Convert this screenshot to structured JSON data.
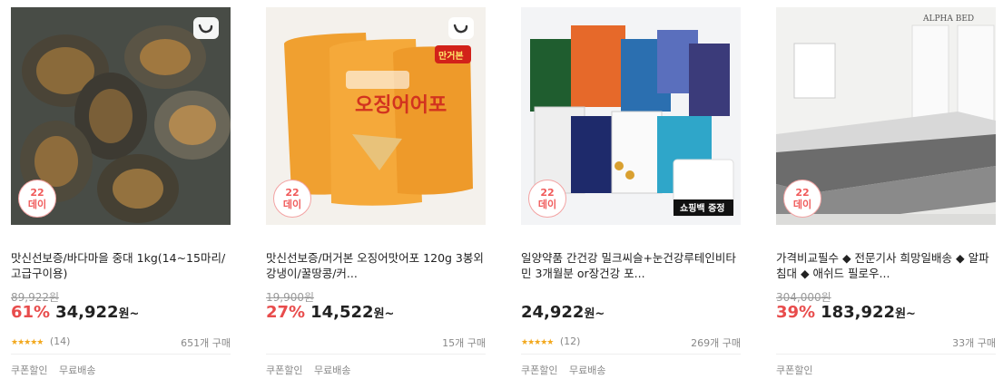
{
  "products": [
    {
      "title": "맛신선보증/바다마을 중대 1kg(14~15마리/고급구이용)",
      "badge_line1": "22",
      "badge_line2": "데이",
      "original_price": "89,922원",
      "discount": "61%",
      "price": "34,922",
      "won": "원~",
      "stars": "★★★★★",
      "reviews": "(14)",
      "sold": "651개 구매",
      "tags": [
        "쿠폰할인",
        "무료배송"
      ]
    },
    {
      "title": "맛신선보증/머거본 오징어맛어포 120g 3봉외 강냉이/꿀땅콩/커...",
      "badge_line1": "22",
      "badge_line2": "데이",
      "original_price": "19,900원",
      "discount": "27%",
      "price": "14,522",
      "won": "원~",
      "stars": "",
      "reviews": "",
      "sold": "15개 구매",
      "tags": [
        "쿠폰할인",
        "무료배송"
      ],
      "image_text": {
        "product_name": "오징어어포",
        "sticker": "만거본"
      }
    },
    {
      "title": "일양약품 간건강 밀크씨슬+눈건강루테인비타민 3개월분 or장건강 포...",
      "badge_line1": "22",
      "badge_line2": "데이",
      "original_price": "",
      "discount": "",
      "price": "24,922",
      "won": "원~",
      "stars": "★★★★★",
      "reviews": "(12)",
      "sold": "269개 구매",
      "tags": [
        "쿠폰할인",
        "무료배송"
      ],
      "image_text": {
        "gift": "쇼핑백 증정"
      }
    },
    {
      "title": "가격비교필수 ◆ 전문기사 희망일배송 ◆ 알파침대 ◆ 애쉬드 필로우...",
      "badge_line1": "22",
      "badge_line2": "데이",
      "original_price": "304,000원",
      "discount": "39%",
      "price": "183,922",
      "won": "원~",
      "stars": "",
      "reviews": "",
      "sold": "33개 구매",
      "tags": [
        "쿠폰할인"
      ],
      "image_text": {
        "brand": "ALPHA BED"
      }
    }
  ],
  "colors": {
    "discount": "#e84c4c",
    "stars": "#f2a81d",
    "badge_border": "#f3a3a3",
    "muted": "#888888"
  }
}
